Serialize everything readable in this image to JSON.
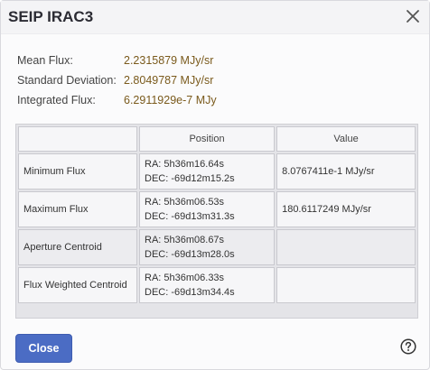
{
  "dialog": {
    "title": "SEIP IRAC3",
    "close_icon": "close-icon",
    "help_icon": "help-icon"
  },
  "stats": [
    {
      "label": "Mean Flux:",
      "value": "2.2315879 MJy/sr"
    },
    {
      "label": "Standard Deviation:",
      "value": "2.8049787 MJy/sr"
    },
    {
      "label": "Integrated Flux:",
      "value": "6.2911929e-7 MJy"
    }
  ],
  "table": {
    "headers": [
      "",
      "Position",
      "Value"
    ],
    "rows": [
      {
        "name": "Minimum Flux",
        "ra": "RA: 5h36m16.64s",
        "dec": "DEC: -69d12m15.2s",
        "value": "8.0767411e-1 MJy/sr"
      },
      {
        "name": "Maximum Flux",
        "ra": "RA: 5h36m06.53s",
        "dec": "DEC: -69d13m31.3s",
        "value": "180.6117249 MJy/sr"
      },
      {
        "name": "Aperture Centroid",
        "ra": "RA: 5h36m08.67s",
        "dec": "DEC: -69d13m28.0s",
        "value": ""
      },
      {
        "name": "Flux Weighted Centroid",
        "ra": "RA: 5h36m06.33s",
        "dec": "DEC: -69d13m34.4s",
        "value": ""
      }
    ]
  },
  "footer": {
    "close_label": "Close"
  },
  "colors": {
    "accent": "#4b6cc4",
    "value_text": "#7a5a1c"
  }
}
